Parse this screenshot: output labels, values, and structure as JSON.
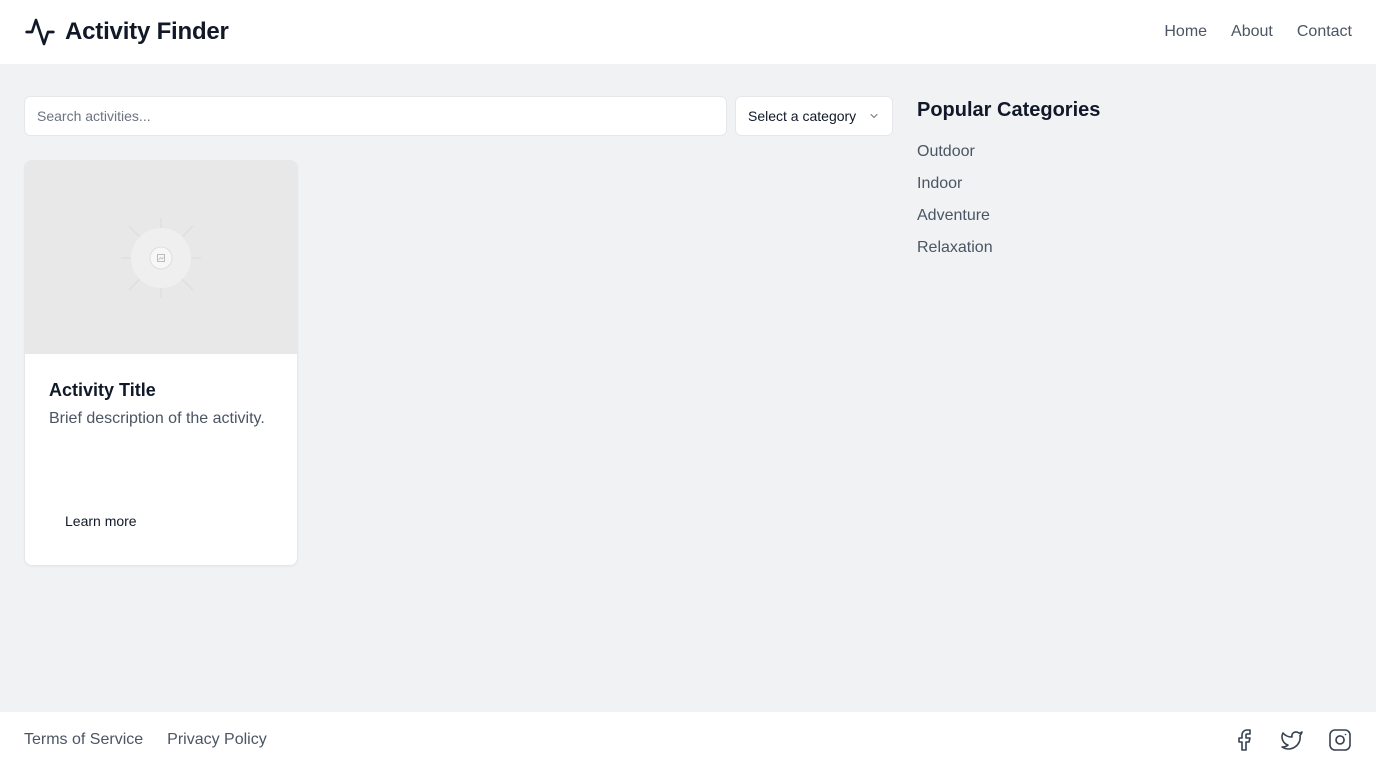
{
  "header": {
    "brand_icon": "activity-pulse-icon",
    "title": "Activity Finder",
    "nav": [
      {
        "label": "Home"
      },
      {
        "label": "About"
      },
      {
        "label": "Contact"
      }
    ]
  },
  "search": {
    "placeholder": "Search activities...",
    "value": ""
  },
  "category_select": {
    "selected": "Select a category",
    "icon": "chevron-down-icon"
  },
  "card": {
    "image_icon": "image-placeholder-icon",
    "title": "Activity Title",
    "description": "Brief description of the activity.",
    "button_label": "Learn more"
  },
  "sidebar": {
    "title": "Popular Categories",
    "categories": [
      "Outdoor",
      "Indoor",
      "Adventure",
      "Relaxation"
    ]
  },
  "footer": {
    "links": [
      "Terms of Service",
      "Privacy Policy"
    ],
    "socials": [
      "facebook-icon",
      "twitter-icon",
      "instagram-icon"
    ]
  },
  "colors": {
    "page_bg": "#f1f2f4",
    "surface": "#ffffff",
    "text_primary": "#111827",
    "text_secondary": "#4b5563",
    "border": "#e5e7eb"
  }
}
